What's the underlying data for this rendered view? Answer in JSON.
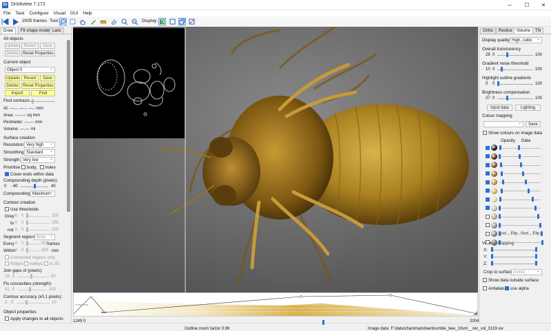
{
  "window": {
    "logo": "Sv",
    "title": "Drishview 7.172",
    "controls": [
      "─",
      "☐",
      "✕"
    ]
  },
  "menu": [
    "File",
    "Task",
    "Configure",
    "Visual",
    "GUI",
    "Help"
  ],
  "toolbar": {
    "frames": "2005 frames",
    "tool_label": "Tool:",
    "display_label": "Display:"
  },
  "left_panel": {
    "tabs": [
      "Draw",
      "Fit shape model",
      "Lanc"
    ],
    "all_objects": {
      "label": "All objects",
      "update": "Update",
      "revert": "Revert",
      "save": "Save",
      "delete": "Delete",
      "reset": "Reset Properties"
    },
    "current_object": {
      "label": "Current object",
      "object_select": "Object 0",
      "update": "Update",
      "revert": "Revert",
      "save": "Save",
      "delete": "Delete",
      "reset": "Reset Properties",
      "import": "Import",
      "find": "Find",
      "find_contours": "Find contours:",
      "at": "At: ---.-, ---.-, ---.- mm",
      "area": "Area: -----.-- sq mm",
      "perimeter": "Perimeter: ---.--- mm",
      "volume": "Volume: ---.--- ml"
    },
    "surface_creation": {
      "label": "Surface creation",
      "resolution_label": "Resolution:",
      "resolution": "Very high",
      "smoothing_label": "Smoothing:",
      "smoothing": "Standard",
      "strength_label": "Strength:",
      "strength": "Very low",
      "prioritise": "Prioritise",
      "body": "body,",
      "holes": "holes",
      "cover_ends": "Cover ends within data",
      "compounding_depth": "Compounding depth (pixels):",
      "depth_min": "0",
      "depth_val": "-40",
      "depth_max": "40",
      "compounding_label": "Compounding:",
      "compounding": "Maximum"
    },
    "contour_creation": {
      "label": "Contour creation",
      "use_thresholds": "Use thresholds",
      "grey": "Grey:",
      "to": "to",
      "not": "not",
      "grey_min": "0",
      "grey_val": "0",
      "grey_max": "255",
      "to_min": "0",
      "to_val": "0",
      "to_max": "255",
      "not_min": "0",
      "not_val": "0",
      "not_max": "255",
      "segment_regions": "Segment regions:",
      "segment_value": "Body",
      "every": "Every",
      "every_val": "0",
      "every_num": "0",
      "every_max": "30",
      "frames": "frames",
      "within": "Within",
      "within_val": "0",
      "within_num": "0",
      "within_max": "300",
      "mm": "mm",
      "connected": "Connected regions only",
      "ridges": "Ridges,",
      "valleys": "valleys,",
      "in3d": "in 3D",
      "join_gaps": "Join gaps of (pixels):",
      "join_a": "26",
      "join_b": "0",
      "join_max": "50",
      "fix_concavities": "Fix concavities (strength):",
      "fix_a": "41",
      "fix_b": "0",
      "fix_max": "100",
      "accuracy": "Contour accuracy (x0.1 pixels):",
      "acc_a": "3",
      "acc_b": "0",
      "acc_max": "10"
    },
    "object_properties": {
      "label": "Object properties",
      "apply_all": "Apply changes to all objects"
    }
  },
  "right_panel": {
    "tabs": [
      "Ortho",
      "Reslice",
      "Volume",
      "Thi"
    ],
    "display_quality_label": "Display quality:",
    "display_quality": "High, cubic",
    "overall_translucency": "Overall translucency",
    "ot_a": "28",
    "ot_b": "0",
    "ot_max": "100",
    "gradient_noise": "Gradient noise threshold",
    "gn_a": "10",
    "gn_b": "0",
    "gn_max": "100",
    "highlight_gradients": "Highlight outline gradients",
    "hg_a": "0",
    "hg_b": "0",
    "hg_max": "100",
    "brightness": "Brightness compensation",
    "br_a": "27",
    "br_b": "0",
    "br_max": "100",
    "input_data": "Input data",
    "lighting": "Lighting",
    "colour_mapping": "Colour mapping",
    "save": "Save",
    "show_colours": "Show colours on image data",
    "opacity": "Opacity",
    "data": "Data",
    "swatch_colors": [
      "#151515",
      "#5a2a10",
      "#8a4a25",
      "#a86a2a",
      "#c89a3a",
      "#d8b860",
      "#e8dcaa",
      "#c8c0b8",
      "#b0a89a",
      "#9a9088",
      "#8a8078",
      "#7a7068"
    ],
    "sort1": "Sort",
    "flip1": "Flip",
    "sort2": "Sort",
    "flip2": "Flip",
    "volume_cropping": "Volume cropping",
    "x": "X:",
    "y": "Y:",
    "z": "Z:",
    "crop_to_surface": "Crop to surface:",
    "crop_value": "(none)",
    "show_outside": "Show data outside surface",
    "antialias": "Antialias,",
    "use_alpha": "use alpha"
  },
  "histogram": {
    "label": "Frequency",
    "min": "0",
    "max": "1249"
  },
  "status": {
    "left_num": "1249 0",
    "outline_zoom": "Outline zoom factor 0.99",
    "frame_max": "2004",
    "image_data": "Image data: F:\\data\\ct\\animals\\bee\\bumble_bee_10um__rec_vol_0119.sw"
  }
}
